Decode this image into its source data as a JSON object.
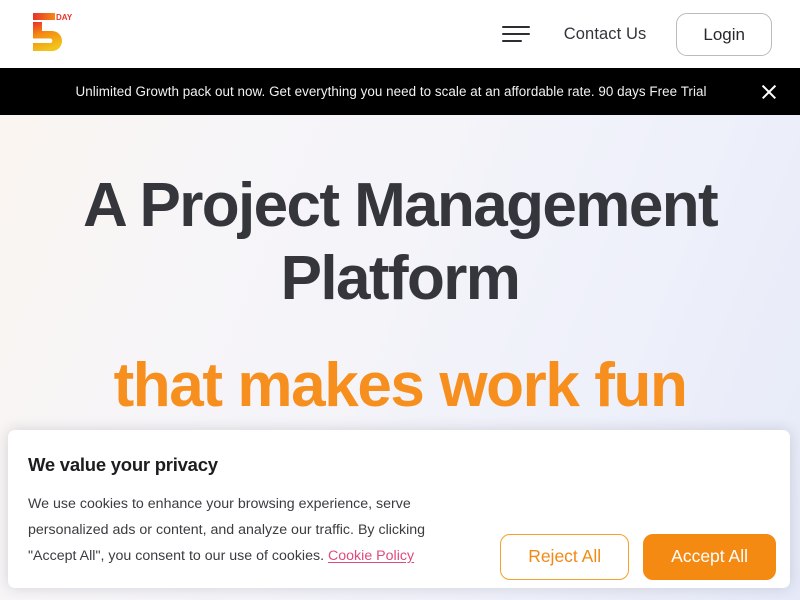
{
  "header": {
    "logo": {
      "name": "5day-logo",
      "digit": "5",
      "word": "DAY",
      "colors": {
        "red": "#e8322a",
        "orange": "#f58a12",
        "yellow": "#f2c31a"
      }
    },
    "menu_icon": "hamburger-menu-icon",
    "nav": [
      {
        "label": "Contact Us",
        "name": "nav-contact-us"
      }
    ],
    "login_label": "Login"
  },
  "announcement": {
    "text": "Unlimited Growth pack out now. Get everything you need to scale at an affordable rate. 90 days Free Trial",
    "close_icon": "close-x-icon",
    "background": "#000000",
    "text_color": "#f2f2f2"
  },
  "hero": {
    "title": "A Project Management Platform",
    "subtitle": "that makes work fun",
    "title_color": "#35363b",
    "subtitle_color": "#f78f1e"
  },
  "cookie_banner": {
    "title": "We value your privacy",
    "description": "We use cookies to enhance your browsing experience, serve personalized ads or content, and analyze our traffic. By clicking \"Accept All\", you consent to our use of cookies. ",
    "policy_link_label": "Cookie Policy",
    "policy_link_color": "#e04a7c",
    "reject_label": "Reject All",
    "accept_label": "Accept All",
    "accent_color": "#f58a12"
  }
}
